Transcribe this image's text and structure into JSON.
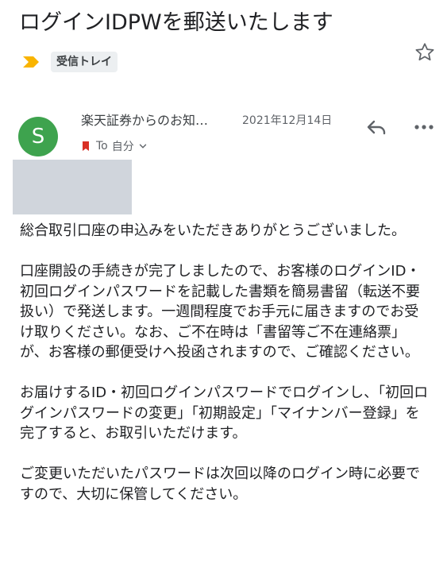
{
  "email": {
    "subject": "ログインIDPWを郵送いたします",
    "label": "受信トレイ",
    "sender": {
      "initial": "S",
      "name": "楽天証券からのお知…",
      "avatar_color": "#3ea34e"
    },
    "date": "2021年12月14日",
    "recipient": {
      "to_label": "To",
      "name": "自分"
    },
    "body": [
      "総合取引口座の申込みをいただきありがとうございました。",
      "口座開設の手続きが完了しましたので、お客様のログインID・初回ログインパスワードを記載した書類を簡易書留（転送不要扱い）で発送します。一週間程度でお手元に届きますのでお受け取りください。なお、ご不在時は「書留等ご不在連絡票」が、お客様の郵便受けへ投函されますので、ご確認ください。",
      "お届けするID・初回ログインパスワードでログインし、「初回ログインパスワードの変更」「初期設定」「マイナンバー登録」を完了すると、お取引いただけます。",
      "ご変更いただいたパスワードは次回以降のログイン時に必要ですので、大切に保管してください。"
    ]
  },
  "icons": {
    "star": "star-icon",
    "label_arrow": "label-important-icon",
    "reply": "reply-icon",
    "more": "more-horizontal-icon",
    "importance": "importance-marker-icon",
    "expand": "chevron-down-icon"
  },
  "colors": {
    "label_arrow": "#f9b400",
    "importance": "#d93025",
    "redaction": "#d0d5dc"
  }
}
